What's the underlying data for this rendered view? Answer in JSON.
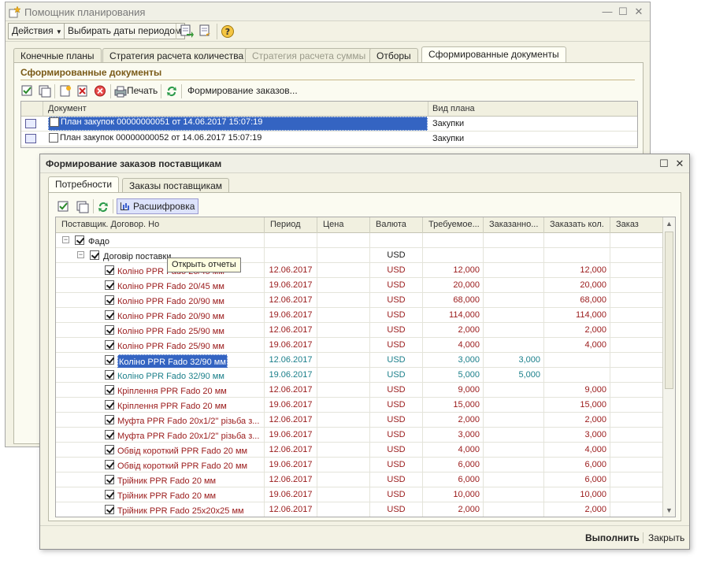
{
  "main_window": {
    "title": "Помощник планирования",
    "toolbar": {
      "actions_label": "Действия",
      "select_period_label": "Выбирать даты периодом"
    },
    "tabs": [
      {
        "label": "Конечные планы",
        "state": "normal"
      },
      {
        "label": "Стратегия расчета количества",
        "state": "normal"
      },
      {
        "label": "Стратегия расчета суммы",
        "state": "disabled"
      },
      {
        "label": "Отборы",
        "state": "normal"
      },
      {
        "label": "Сформированные документы",
        "state": "active"
      }
    ],
    "section_title": "Сформированные документы",
    "subtoolbar": {
      "print_label": "Печать",
      "form_orders_label": "Формирование заказов..."
    },
    "doc_table": {
      "headers": {
        "document": "Документ",
        "plan_type": "Вид плана"
      },
      "rows": [
        {
          "document": "План закупок 00000000051 от 14.06.2017 15:07:19",
          "plan_type": "Закупки",
          "selected": true
        },
        {
          "document": "План закупок 00000000052 от 14.06.2017 15:07:19",
          "plan_type": "Закупки",
          "selected": false
        }
      ]
    }
  },
  "dialog": {
    "title": "Формирование заказов поставщикам",
    "tabs": [
      {
        "label": "Потребности",
        "state": "active"
      },
      {
        "label": "Заказы поставщикам",
        "state": "normal"
      }
    ],
    "toolbar": {
      "rasshifrovka_label": "Расшифровка"
    },
    "tooltip": "Открыть отчеты",
    "grid": {
      "headers": {
        "name": "Поставщик. Договор. Но",
        "period": "Период",
        "price": "Цена",
        "currency": "Валюта",
        "required": "Требуемое...",
        "ordered": "Заказанно...",
        "to_order": "Заказать кол.",
        "order": "Заказ"
      },
      "rows": [
        {
          "name": "Фадо",
          "level": 0,
          "period": "",
          "currency": "",
          "required": "",
          "ordered": "",
          "to_order": "",
          "color": "normal"
        },
        {
          "name": "Договір поставки",
          "level": 1,
          "period": "",
          "currency": "USD",
          "required": "",
          "ordered": "",
          "to_order": "",
          "color": "normal"
        },
        {
          "name": "Коліно PPR Fado 20/45 мм",
          "level": 2,
          "period": "12.06.2017",
          "currency": "USD",
          "required": "12,000",
          "ordered": "",
          "to_order": "12,000",
          "color": "red"
        },
        {
          "name": "Коліно PPR Fado 20/45 мм",
          "level": 2,
          "period": "19.06.2017",
          "currency": "USD",
          "required": "20,000",
          "ordered": "",
          "to_order": "20,000",
          "color": "red"
        },
        {
          "name": "Коліно PPR Fado 20/90 мм",
          "level": 2,
          "period": "12.06.2017",
          "currency": "USD",
          "required": "68,000",
          "ordered": "",
          "to_order": "68,000",
          "color": "red"
        },
        {
          "name": "Коліно PPR Fado 20/90 мм",
          "level": 2,
          "period": "19.06.2017",
          "currency": "USD",
          "required": "114,000",
          "ordered": "",
          "to_order": "114,000",
          "color": "red"
        },
        {
          "name": "Коліно PPR Fado 25/90 мм",
          "level": 2,
          "period": "12.06.2017",
          "currency": "USD",
          "required": "2,000",
          "ordered": "",
          "to_order": "2,000",
          "color": "red"
        },
        {
          "name": "Коліно PPR Fado 25/90 мм",
          "level": 2,
          "period": "19.06.2017",
          "currency": "USD",
          "required": "4,000",
          "ordered": "",
          "to_order": "4,000",
          "color": "red"
        },
        {
          "name": "Коліно PPR Fado 32/90 мм",
          "level": 2,
          "period": "12.06.2017",
          "currency": "USD",
          "required": "3,000",
          "ordered": "3,000",
          "to_order": "",
          "color": "teal",
          "selected": true
        },
        {
          "name": "Коліно PPR Fado 32/90 мм",
          "level": 2,
          "period": "19.06.2017",
          "currency": "USD",
          "required": "5,000",
          "ordered": "5,000",
          "to_order": "",
          "color": "teal"
        },
        {
          "name": "Кріплення PPR Fado 20 мм",
          "level": 2,
          "period": "12.06.2017",
          "currency": "USD",
          "required": "9,000",
          "ordered": "",
          "to_order": "9,000",
          "color": "red"
        },
        {
          "name": "Кріплення PPR Fado 20 мм",
          "level": 2,
          "period": "19.06.2017",
          "currency": "USD",
          "required": "15,000",
          "ordered": "",
          "to_order": "15,000",
          "color": "red"
        },
        {
          "name": "Муфта PPR Fado 20x1/2'' різьба з...",
          "level": 2,
          "period": "12.06.2017",
          "currency": "USD",
          "required": "2,000",
          "ordered": "",
          "to_order": "2,000",
          "color": "red"
        },
        {
          "name": "Муфта PPR Fado 20x1/2'' різьба з...",
          "level": 2,
          "period": "19.06.2017",
          "currency": "USD",
          "required": "3,000",
          "ordered": "",
          "to_order": "3,000",
          "color": "red"
        },
        {
          "name": "Обвід короткий PPR Fado 20 мм",
          "level": 2,
          "period": "12.06.2017",
          "currency": "USD",
          "required": "4,000",
          "ordered": "",
          "to_order": "4,000",
          "color": "red"
        },
        {
          "name": "Обвід короткий PPR Fado 20 мм",
          "level": 2,
          "period": "19.06.2017",
          "currency": "USD",
          "required": "6,000",
          "ordered": "",
          "to_order": "6,000",
          "color": "red"
        },
        {
          "name": "Трійник PPR Fado 20 мм",
          "level": 2,
          "period": "12.06.2017",
          "currency": "USD",
          "required": "6,000",
          "ordered": "",
          "to_order": "6,000",
          "color": "red"
        },
        {
          "name": "Трійник PPR Fado 20 мм",
          "level": 2,
          "period": "19.06.2017",
          "currency": "USD",
          "required": "10,000",
          "ordered": "",
          "to_order": "10,000",
          "color": "red"
        },
        {
          "name": "Трійник PPR Fado 25x20x25 мм",
          "level": 2,
          "period": "12.06.2017",
          "currency": "USD",
          "required": "2,000",
          "ordered": "",
          "to_order": "2,000",
          "color": "red"
        }
      ]
    },
    "footer": {
      "execute_label": "Выполнить",
      "close_label": "Закрыть"
    }
  },
  "colors": {
    "selection": "#3464c2",
    "red_text": "#9a1a1a",
    "teal_text": "#1a7f8a",
    "section_title": "#7a5a18"
  }
}
